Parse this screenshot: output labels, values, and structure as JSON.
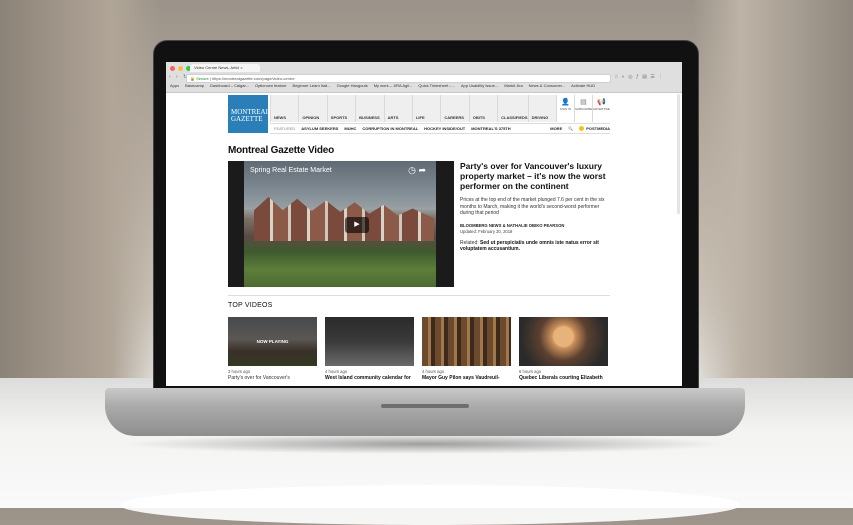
{
  "browser": {
    "tab_title": "Video Centre News, Articl",
    "address_secure": "Secure",
    "address_url": "https://montrealgazette.com/page/video-centre",
    "bookmarks": [
      "Apps",
      "Basecamp",
      "Dashboard – Calgar...",
      "Opticrown feature",
      "Beginner Learn Itali...",
      "Google Hangouts",
      "My work – JIRA Agil...",
      "Quick Timesheet –...",
      "App Usability Issue...",
      "Markit Jira",
      "News & Consumer...",
      "Activate HUD"
    ]
  },
  "site": {
    "logo_line1": "MONTREAL",
    "logo_line2": "GAZETTE",
    "nav": [
      "NEWS",
      "OPINION",
      "SPORTS",
      "BUSINESS",
      "ARTS",
      "LIFE",
      "CAREERS",
      "OBITS",
      "CLASSIFIEDS",
      "DRIVING"
    ],
    "nav_icons": [
      {
        "label": "SIGN IN",
        "icon": "user-icon"
      },
      {
        "label": "SUBSCRIBE",
        "icon": "newspaper-icon"
      },
      {
        "label": "ADVERTISE",
        "icon": "megaphone-icon"
      }
    ],
    "featured_label": "FEATURED",
    "featured": [
      "ASYLUM SEEKERS",
      "MUHC",
      "CORRUPTION IN MONTREAL",
      "HOCKEY INSIDE/OUT",
      "MONTREAL'S 375TH"
    ],
    "more": "MORE",
    "postmedia": "POSTMEDIA"
  },
  "page_title": "Montreal Gazette Video",
  "player": {
    "title": "Spring Real Estate Market"
  },
  "story": {
    "headline": "Party's over for Vancouver's luxury property market – it's now the worst performer on the continent",
    "dek": "Prices at the top end of the market plunged 7.6 per cent in the six months to March, making it the world's second-worst performer during that period",
    "byline": "BLOOMBERG NEWS & NATHALIE OBIKO PEARSON",
    "updated": "Updated: February 20, 2018",
    "related_label": "Related:",
    "related_text": "Sed ut perspiciatis unde omnis iste natus error sit voluptatem accusantium."
  },
  "top_videos": {
    "title": "TOP VIDEOS",
    "now_playing": "NOW PLAYING",
    "items": [
      {
        "ago": "3 hours ago",
        "caption": "Party's over for Vancouver's"
      },
      {
        "ago": "4 hours ago",
        "caption": "West Island community calendar for"
      },
      {
        "ago": "4 hours ago",
        "caption": "Mayor Guy Pilon says Vaudreuil-"
      },
      {
        "ago": "6 hours ago",
        "caption": "Quebec Liberals courting Elizabeth"
      }
    ]
  }
}
